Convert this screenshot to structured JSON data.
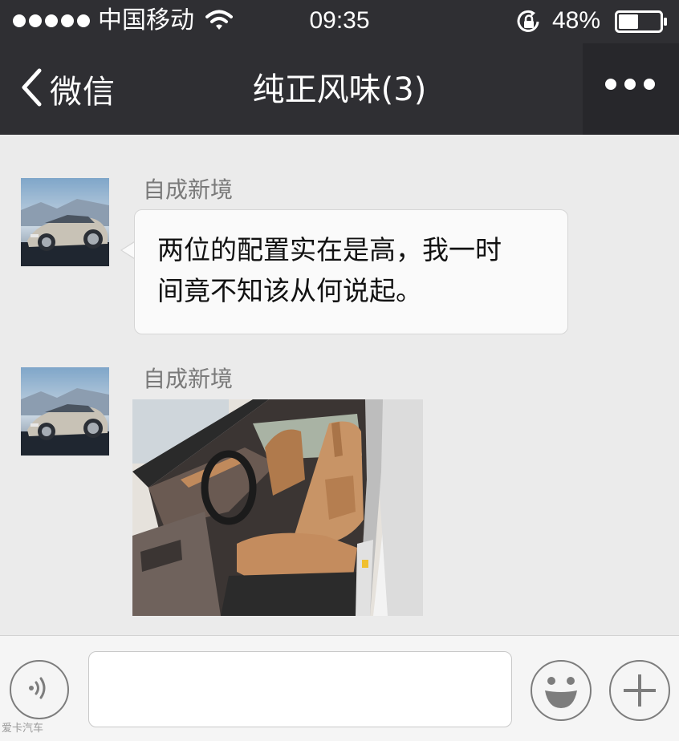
{
  "status_bar": {
    "carrier": "中国移动",
    "time": "09:35",
    "battery_percent": "48%",
    "battery_level": 0.48,
    "signal_strength": 5,
    "icons": [
      "signal-dots-icon",
      "wifi-icon",
      "rotation-lock-icon",
      "battery-icon"
    ]
  },
  "nav": {
    "back_label": "微信",
    "title": "纯正风味(3)",
    "icons": [
      "chevron-left-icon",
      "more-dots-icon"
    ]
  },
  "messages": [
    {
      "sender": "自成新境",
      "type": "text",
      "lines": [
        "两位的配置实在是高，我一时",
        "间竟不知该从何说起。"
      ]
    },
    {
      "sender": "自成新境",
      "type": "image",
      "image_subject": "car-interior-seats-photo"
    }
  ],
  "input_bar": {
    "placeholder": "",
    "value": "",
    "icons": [
      "voice-icon",
      "emoji-icon",
      "plus-icon"
    ]
  },
  "watermark": "爱卡汽车",
  "colors": {
    "header_bg": "#2f2f33",
    "chat_bg": "#ebebeb",
    "bubble_bg": "#fafafa",
    "input_bar_bg": "#f5f5f5",
    "sender_name": "#7a7a7a"
  }
}
